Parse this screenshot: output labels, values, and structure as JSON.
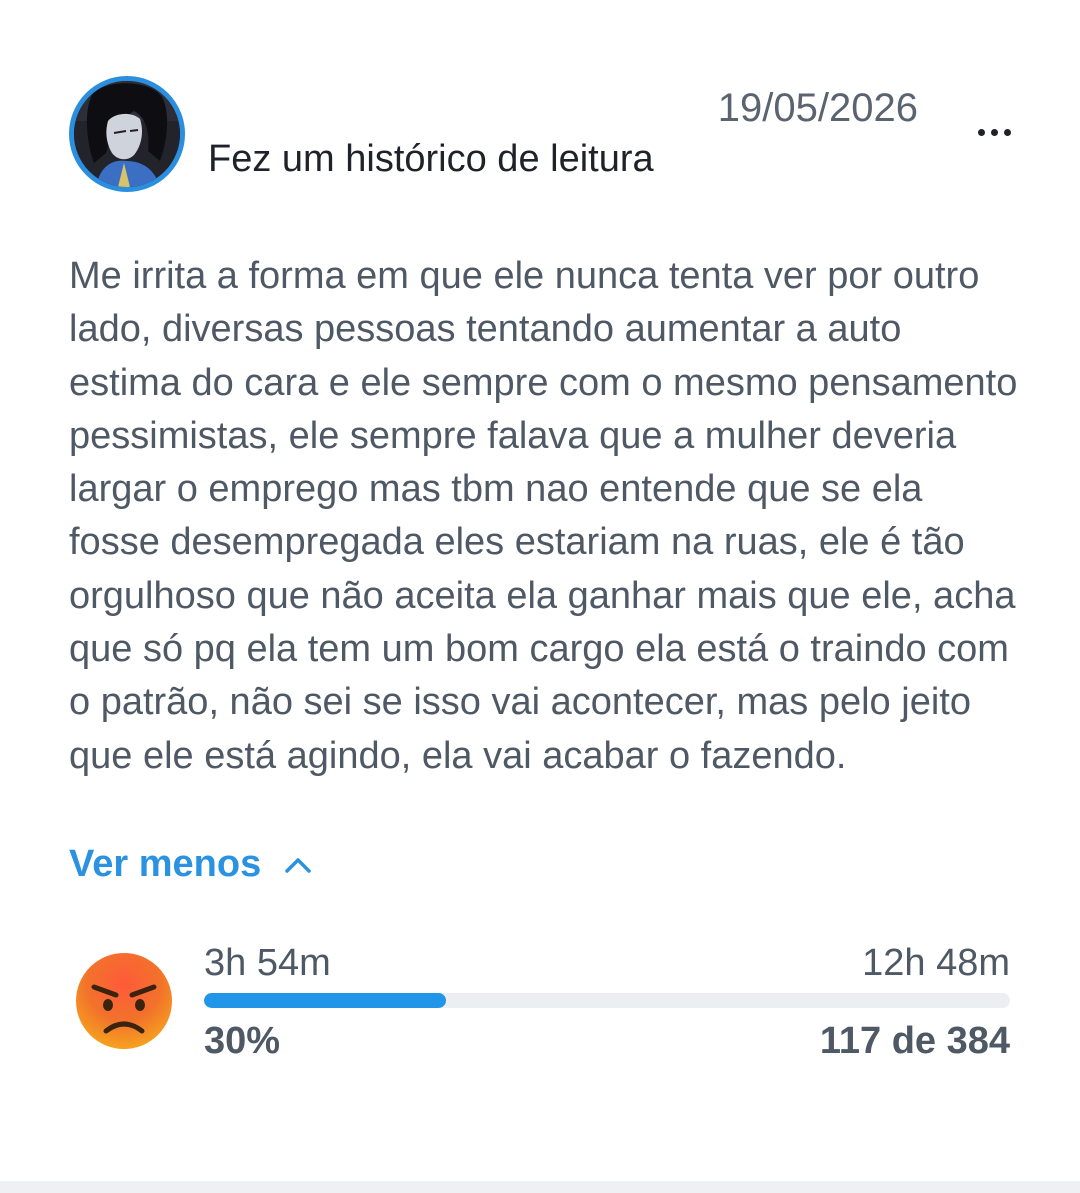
{
  "post": {
    "avatar_icon": "user-avatar-icon",
    "activity": "Fez um histórico de leitura",
    "date": "19/05/2026",
    "more_icon": "more-options-icon",
    "review_text": "Me irrita a forma em que ele nunca tenta ver por outro lado, diversas pessoas tentando aumentar a auto estima do cara e ele sempre com o mesmo pensamento pessimistas, ele sempre falava que a mulher deveria largar o emprego mas tbm nao entende que se ela fosse desempregada eles estariam na ruas, ele é tão orgulhoso que não aceita ela ganhar mais que ele, acha que só pq ela tem um bom cargo ela está o traindo com o patrão, não sei se isso vai acontecer, mas pelo jeito que ele está agindo, ela vai acabar o fazendo.",
    "toggle_label": "Ver menos",
    "toggle_icon": "chevron-up-icon"
  },
  "progress": {
    "reaction_icon": "angry-face-icon",
    "time_read": "3h 54m",
    "time_total": "12h 48m",
    "percent_label": "30%",
    "fraction": 0.3,
    "chapters_label": "117 de 384"
  },
  "colors": {
    "accent": "#2196e8",
    "avatar_ring": "#2b8fe0",
    "text_primary": "#1f2329",
    "text_secondary": "#4f5965",
    "track": "#eceff2"
  }
}
